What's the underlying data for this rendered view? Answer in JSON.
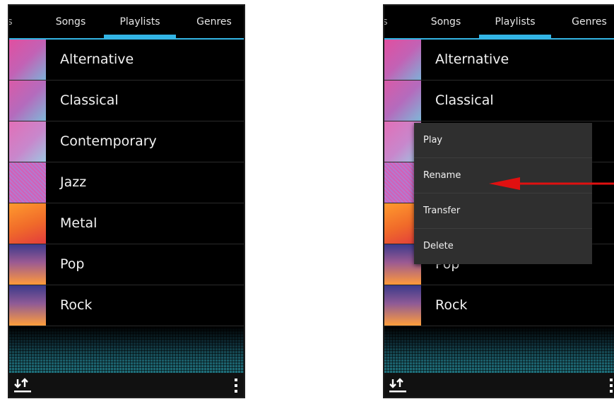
{
  "tabs": {
    "left_clip": "s",
    "songs": "Songs",
    "playlists": "Playlists",
    "genres": "Genres"
  },
  "playlists": [
    {
      "label": "Alternative",
      "art": "grad-alt"
    },
    {
      "label": "Classical",
      "art": "grad-cls"
    },
    {
      "label": "Contemporary",
      "art": "grad-con"
    },
    {
      "label": "Jazz",
      "art": "grad-jazz"
    },
    {
      "label": "Metal",
      "art": "grad-metal"
    },
    {
      "label": "Pop",
      "art": "grad-pop"
    },
    {
      "label": "Rock",
      "art": "grad-rock"
    }
  ],
  "context_menu": {
    "items": [
      "Play",
      "Rename",
      "Transfer",
      "Delete"
    ]
  },
  "bottombar": {
    "left_icon": "sort-icon",
    "right_icon": "overflow-menu-icon"
  },
  "colors": {
    "accent": "#33b5e5",
    "annotation_arrow": "#e01010"
  }
}
